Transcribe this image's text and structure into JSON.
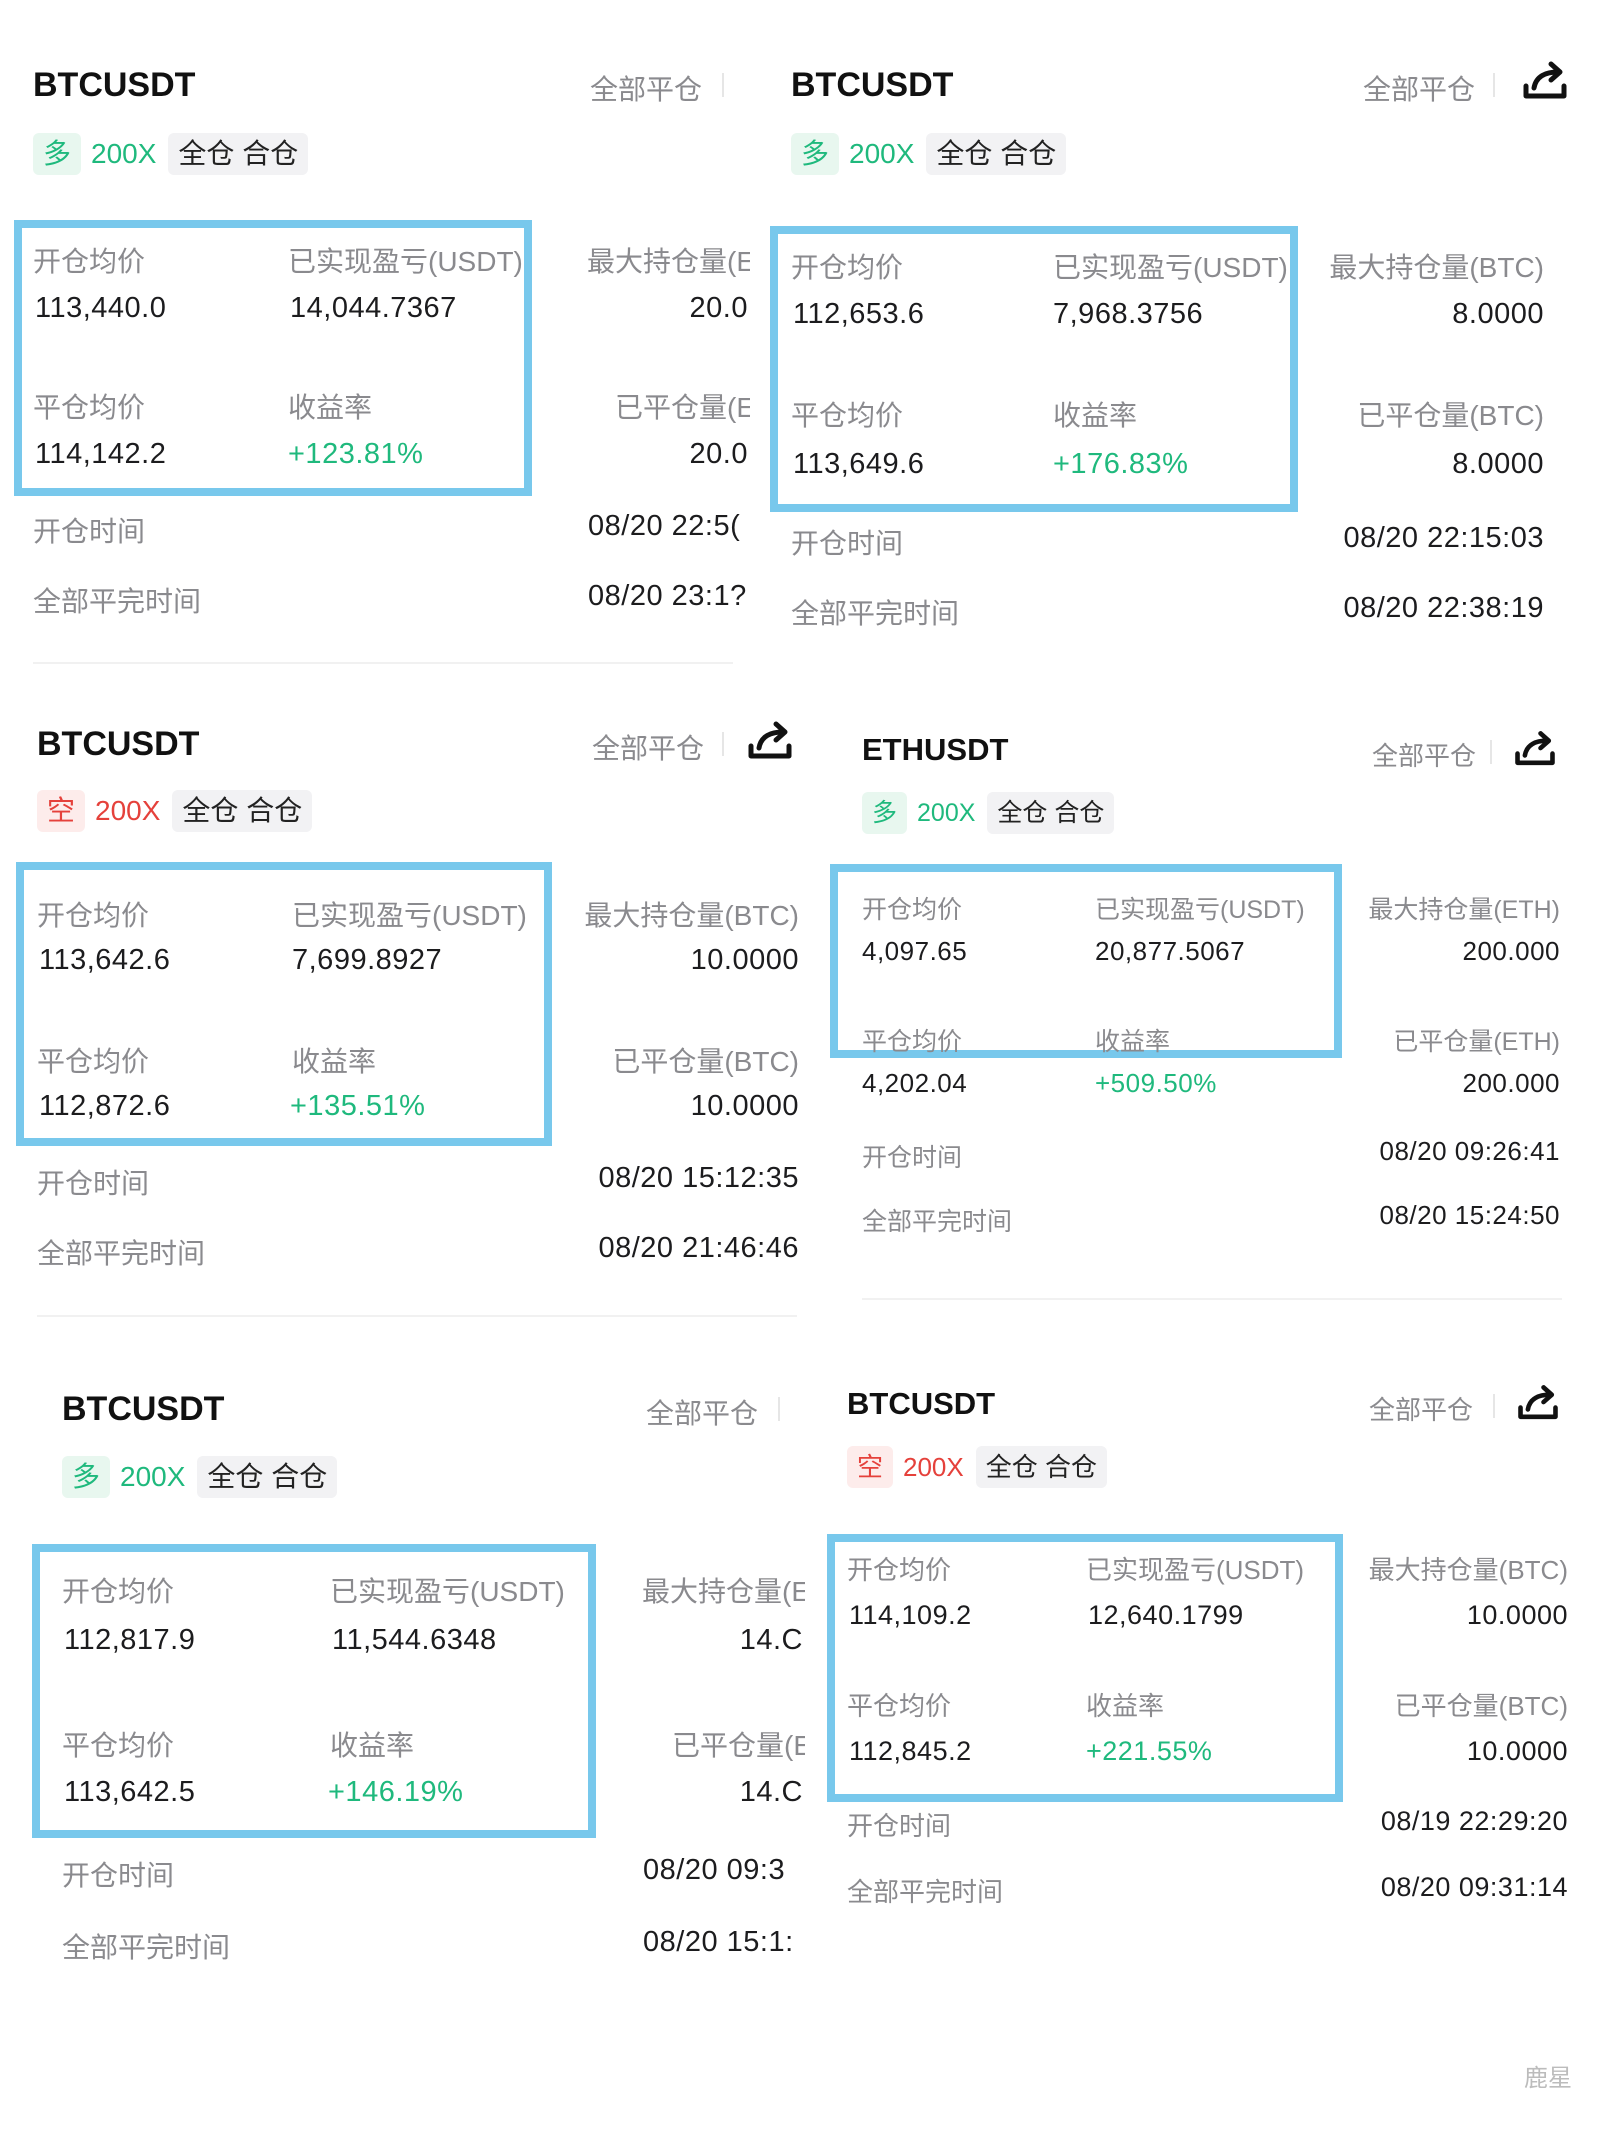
{
  "labels": {
    "close_all": "全部平仓",
    "open_avg": "开仓均价",
    "realized_pnl": "已实现盈亏(USDT)",
    "close_avg": "平仓均价",
    "roi": "收益率",
    "open_time": "开仓时间",
    "close_done_time": "全部平完时间"
  },
  "colors": {
    "long": "#1fb97d",
    "short": "#e5413b",
    "highlight": "#78c8ec"
  },
  "icons": {
    "share": "share-icon"
  },
  "cards": [
    {
      "symbol": "BTCUSDT",
      "direction": "多",
      "side": "long",
      "leverage": "200X",
      "mode": "全仓 合仓",
      "open_avg": "113,440.0",
      "realized_pnl": "14,044.7367",
      "close_avg": "114,142.2",
      "roi": "+123.81%",
      "max_position_label": "最大持仓量(E",
      "max_position": "20.0",
      "closed_position_label": "已平仓量(E",
      "closed_position": "20.0",
      "open_time": "08/20 22:5(",
      "close_time": "08/20 23:1?"
    },
    {
      "symbol": "BTCUSDT",
      "direction": "多",
      "side": "long",
      "leverage": "200X",
      "mode": "全仓 合仓",
      "open_avg": "112,653.6",
      "realized_pnl": "7,968.3756",
      "close_avg": "113,649.6",
      "roi": "+176.83%",
      "max_position_label": "最大持仓量(BTC)",
      "max_position": "8.0000",
      "closed_position_label": "已平仓量(BTC)",
      "closed_position": "8.0000",
      "open_time": "08/20 22:15:03",
      "close_time": "08/20 22:38:19"
    },
    {
      "symbol": "BTCUSDT",
      "direction": "空",
      "side": "short",
      "leverage": "200X",
      "mode": "全仓 合仓",
      "open_avg": "113,642.6",
      "realized_pnl": "7,699.8927",
      "close_avg": "112,872.6",
      "roi": "+135.51%",
      "max_position_label": "最大持仓量(BTC)",
      "max_position": "10.0000",
      "closed_position_label": "已平仓量(BTC)",
      "closed_position": "10.0000",
      "open_time": "08/20 15:12:35",
      "close_time": "08/20 21:46:46"
    },
    {
      "symbol": "ETHUSDT",
      "direction": "多",
      "side": "long",
      "leverage": "200X",
      "mode": "全仓 合仓",
      "open_avg": "4,097.65",
      "realized_pnl": "20,877.5067",
      "close_avg": "4,202.04",
      "roi": "+509.50%",
      "max_position_label": "最大持仓量(ETH)",
      "max_position": "200.000",
      "closed_position_label": "已平仓量(ETH)",
      "closed_position": "200.000",
      "open_time": "08/20 09:26:41",
      "close_time": "08/20 15:24:50"
    },
    {
      "symbol": "BTCUSDT",
      "direction": "多",
      "side": "long",
      "leverage": "200X",
      "mode": "全仓 合仓",
      "open_avg": "112,817.9",
      "realized_pnl": "11,544.6348",
      "close_avg": "113,642.5",
      "roi": "+146.19%",
      "max_position_label": "最大持仓量(E",
      "max_position": "14.C",
      "closed_position_label": "已平仓量(E",
      "closed_position": "14.C",
      "open_time": "08/20 09:3",
      "close_time": "08/20 15:1:"
    },
    {
      "symbol": "BTCUSDT",
      "direction": "空",
      "side": "short",
      "leverage": "200X",
      "mode": "全仓 合仓",
      "open_avg": "114,109.2",
      "realized_pnl": "12,640.1799",
      "close_avg": "112,845.2",
      "roi": "+221.55%",
      "max_position_label": "最大持仓量(BTC)",
      "max_position": "10.0000",
      "closed_position_label": "已平仓量(BTC)",
      "closed_position": "10.0000",
      "open_time": "08/19 22:29:20",
      "close_time": "08/20 09:31:14"
    }
  ],
  "watermark": "鹿星"
}
